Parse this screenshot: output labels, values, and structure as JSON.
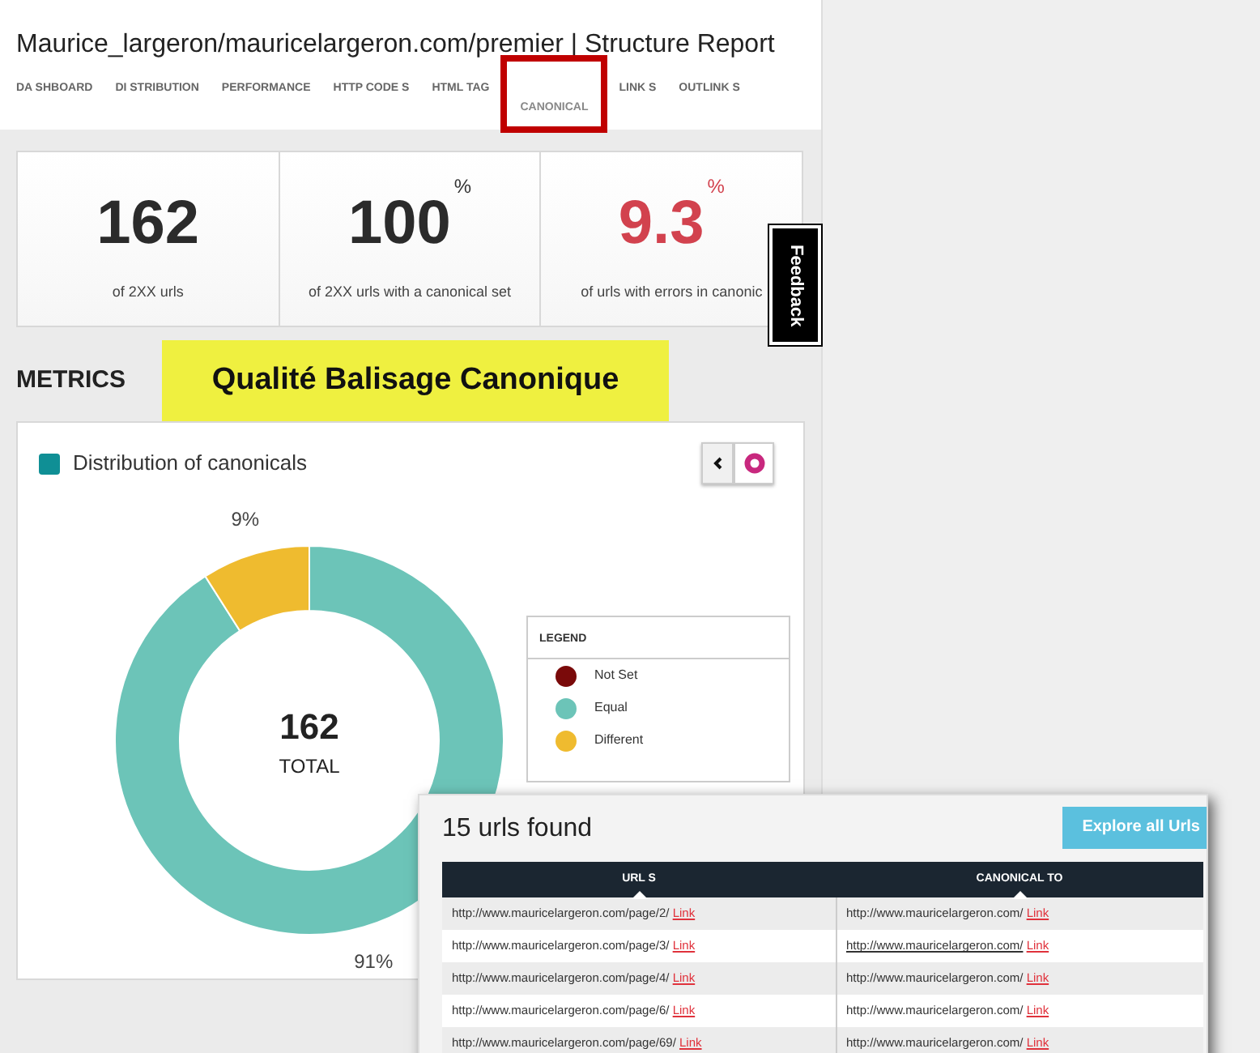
{
  "page": {
    "title": "Maurice_largeron/mauricelargeron.com/premier | Structure Report"
  },
  "tabs": [
    {
      "label": "DA SHBOARD",
      "selected": false,
      "highlighted": false
    },
    {
      "label": "DI STRIBUTION",
      "selected": false,
      "highlighted": false
    },
    {
      "label": "PERFORMANCE",
      "selected": false,
      "highlighted": false
    },
    {
      "label": "HTTP CODE S",
      "selected": false,
      "highlighted": false
    },
    {
      "label": "HTML TAG",
      "selected": false,
      "highlighted": false
    },
    {
      "label": "CANONICAL",
      "selected": true,
      "highlighted": true
    },
    {
      "label": "LINK S",
      "selected": false,
      "highlighted": false
    },
    {
      "label": "OUTLINK S",
      "selected": false,
      "highlighted": false
    }
  ],
  "stats": [
    {
      "value": "162",
      "caption": "of 2XX urls",
      "kind": "plain"
    },
    {
      "value": "100",
      "unit": "%",
      "caption": "of 2XX urls with a canonical set",
      "kind": "plain"
    },
    {
      "value": "9.3",
      "unit": "%",
      "caption": "of urls with errors in canonic",
      "kind": "alert"
    }
  ],
  "feedback_tab": {
    "label": "Feedback"
  },
  "metrics": {
    "heading": "METRICS",
    "annotation": "Qualité Balisage Canonique"
  },
  "chart_panel": {
    "center_value": "162",
    "center_label": "TOTAL",
    "chart_data": {
      "type": "donut",
      "title": "Distribution of canonicals",
      "categories": [
        "Not Set",
        "Equal",
        "Different"
      ],
      "values": [
        0,
        91,
        9
      ],
      "value_labels": [
        null,
        "91%",
        "9%"
      ]
    },
    "legend": {
      "title": "LEGEND",
      "items": [
        {
          "color": "#7a0a0a"
        },
        {
          "color": "#6cc4b8"
        },
        {
          "color": "#efbb2f"
        }
      ]
    }
  },
  "results": {
    "title": "15 urls found",
    "button": "Explore all Urls",
    "columns": [
      "URL S",
      "CANONICAL TO"
    ],
    "rows": [
      {
        "url": "http://www.mauricelargeron.com/page/2/",
        "url_link": "Link",
        "canonical": "http://www.mauricelargeron.com/",
        "canonical_link": "Link",
        "hovered": false
      },
      {
        "url": "http://www.mauricelargeron.com/page/3/",
        "url_link": "Link",
        "canonical": "http://www.mauricelargeron.com/",
        "canonical_link": "Link",
        "hovered": true
      },
      {
        "url": "http://www.mauricelargeron.com/page/4/",
        "url_link": "Link",
        "canonical": "http://www.mauricelargeron.com/",
        "canonical_link": "Link",
        "hovered": false
      },
      {
        "url": "http://www.mauricelargeron.com/page/6/",
        "url_link": "Link",
        "canonical": "http://www.mauricelargeron.com/",
        "canonical_link": "Link",
        "hovered": false
      },
      {
        "url": "http://www.mauricelargeron.com/page/69/",
        "url_link": "Link",
        "canonical": "http://www.mauricelargeron.com/",
        "canonical_link": "Link",
        "hovered": false
      }
    ]
  }
}
